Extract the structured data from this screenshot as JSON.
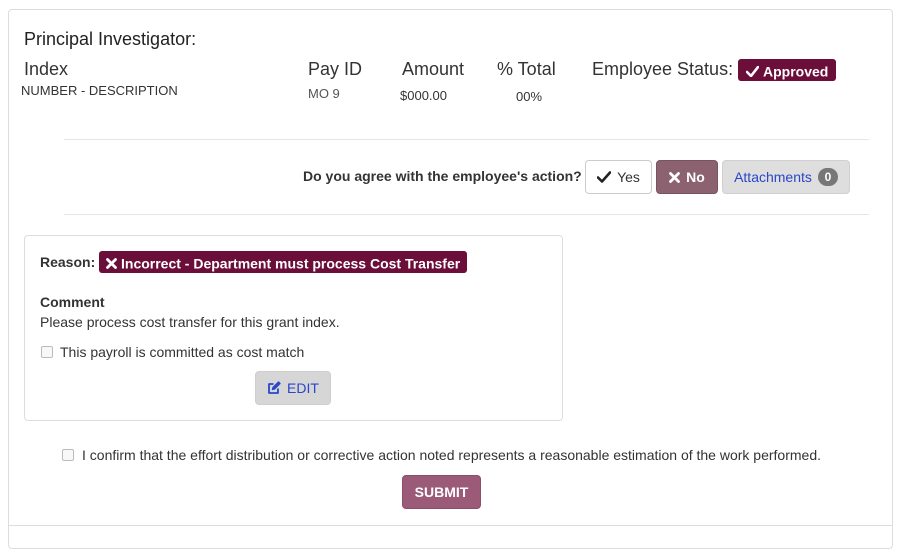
{
  "header": {
    "pi_label": "Principal Investigator:",
    "index_label": "Index",
    "index_value": "NUMBER - DESCRIPTION",
    "pay_id_label": "Pay ID",
    "pay_id_value": "MO 9",
    "amount_label": "Amount",
    "amount_value": "$000.00",
    "percent_label": "% Total",
    "percent_value": "00%",
    "employee_status_label": "Employee Status:",
    "employee_status_value": "Approved"
  },
  "agreement": {
    "question": "Do you agree with the employee's action?",
    "yes_label": "Yes",
    "no_label": "No",
    "attachments_label": "Attachments",
    "attachments_count": "0"
  },
  "reason_panel": {
    "reason_label": "Reason:",
    "reason_value": "Incorrect - Department must process Cost Transfer",
    "comment_label": "Comment",
    "comment_text": "Please process cost transfer for this grant index.",
    "cost_match_label": "This payroll is committed as cost match",
    "edit_label": "EDIT"
  },
  "footer": {
    "confirm_text": "I confirm that the effort distribution or corrective action noted represents a reasonable estimation of the work performed.",
    "submit_label": "SUBMIT"
  },
  "colors": {
    "approved_badge": "#6b0f3a",
    "no_button": "#8c6270",
    "submit_button": "#9b5a78",
    "link_blue": "#2a46c9"
  },
  "icons": [
    "checkmark-icon",
    "x-icon",
    "edit-icon"
  ]
}
